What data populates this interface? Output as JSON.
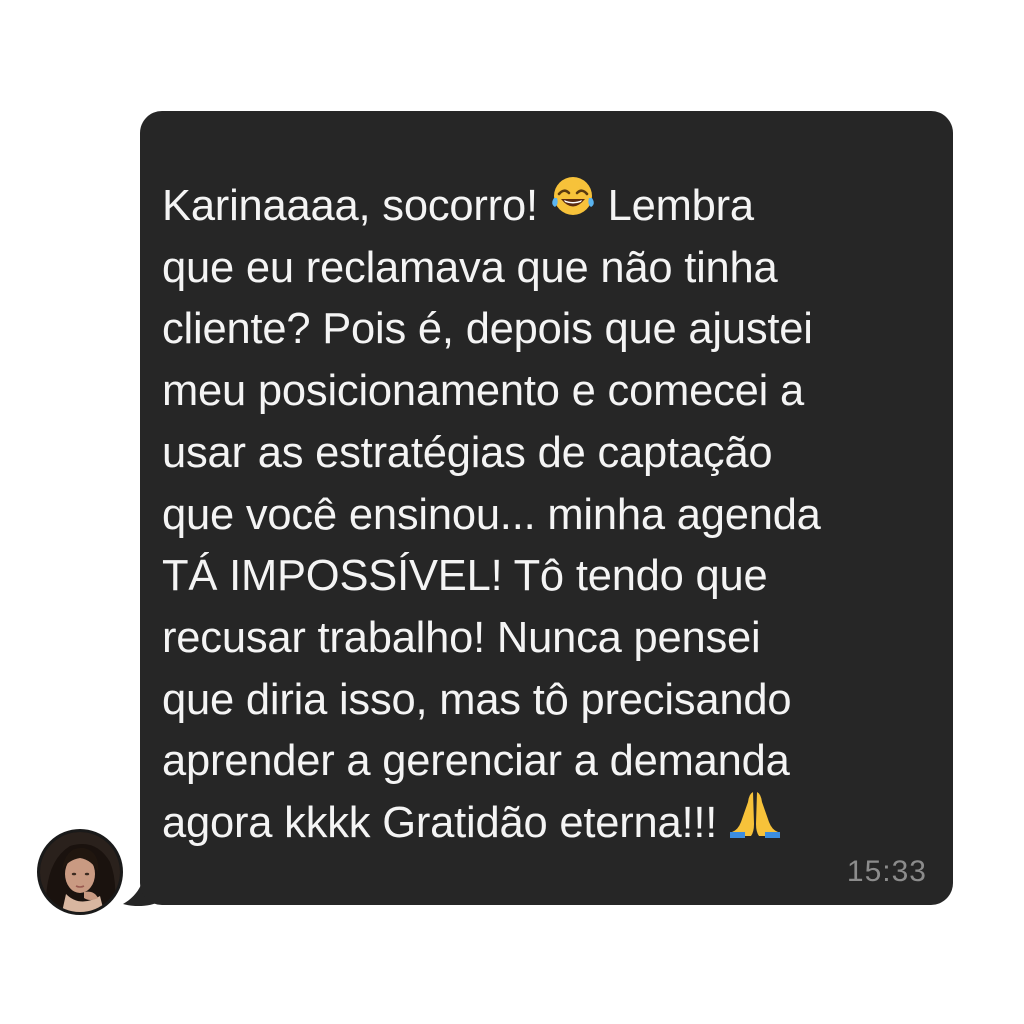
{
  "chat": {
    "message_lines": [
      "Karinaaaa, socorro!",
      "Lembra",
      "que eu reclamava que não tinha",
      "cliente? Pois é, depois que ajustei",
      "meu posicionamento e comecei a",
      "usar as estratégias de captação",
      "que você ensinou... minha agenda",
      "TÁ IMPOSSÍVEL! Tô tendo que",
      "recusar trabalho! Nunca pensei",
      "que diria isso, mas tô precisando",
      "aprender a gerenciar a demanda",
      "agora kkkk Gratidão eterna!!!"
    ],
    "emojis": [
      "tears-of-joy-emoji",
      "folded-hands-emoji"
    ],
    "timestamp": "15:33"
  },
  "colors": {
    "bubble": "#262626",
    "text": "#f4f4f4",
    "timestamp": "#8c8c8c",
    "background": "#ffffff"
  }
}
